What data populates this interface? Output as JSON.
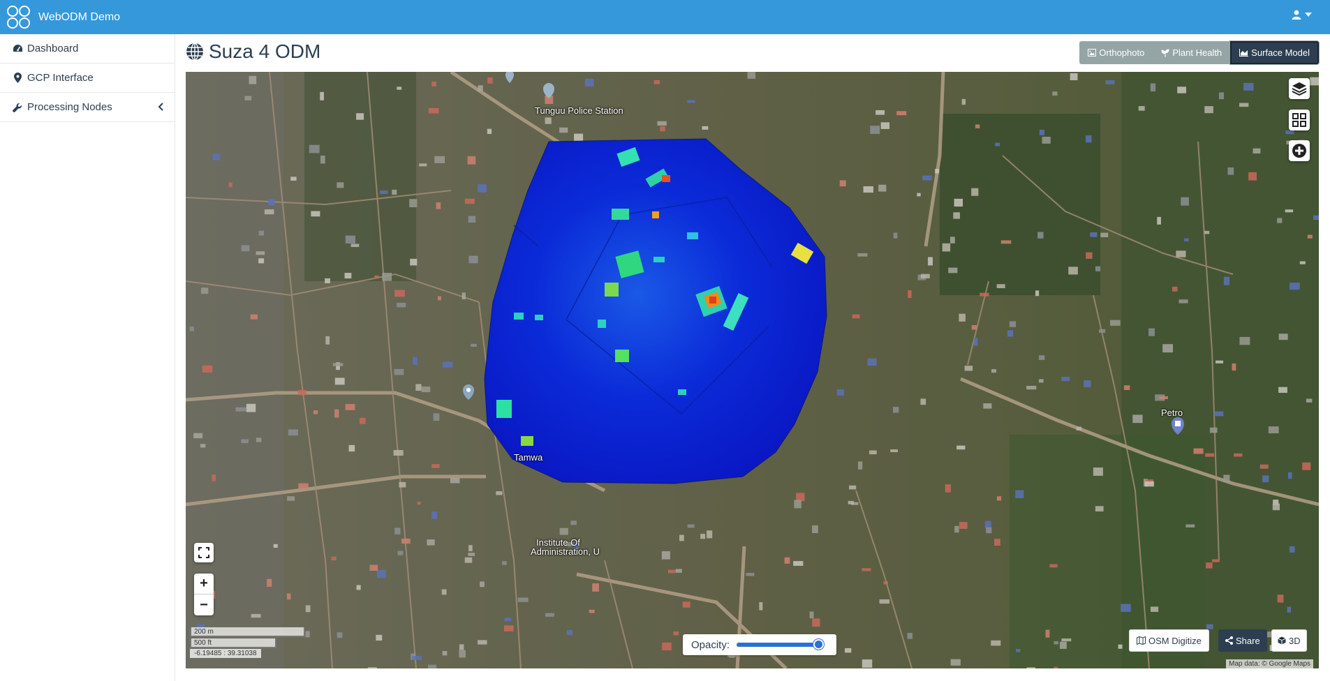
{
  "app": {
    "title": "WebODM Demo"
  },
  "sidebar": {
    "items": [
      {
        "label": "Dashboard",
        "icon": "tachometer-icon"
      },
      {
        "label": "GCP Interface",
        "icon": "map-marker-icon"
      },
      {
        "label": "Processing Nodes",
        "icon": "wrench-icon"
      }
    ]
  },
  "page": {
    "title": "Suza 4 ODM"
  },
  "modes": {
    "orthophoto": "Orthophoto",
    "plant_health": "Plant Health",
    "surface_model": "Surface Model",
    "active": "Surface Model"
  },
  "map": {
    "labels": {
      "police": "Tunguu Police Station",
      "tamwa": "Tamwa",
      "institute_line1": "Institute Of",
      "institute_line2": "Administration, U",
      "petro": "Petro"
    },
    "scale_m": "200 m",
    "scale_ft": "500 ft",
    "coords": "-6.19485 : 39.31038",
    "opacity_label": "Opacity:",
    "opacity_value": 1.0,
    "osm_digitize": "OSM Digitize",
    "share": "Share",
    "three_d": "3D",
    "attribution": "Map data: © Google Maps"
  },
  "colors": {
    "navbar": "#3498db",
    "text": "#2c3e50",
    "button_gray": "#95a5a6",
    "button_dark": "#2c3e50",
    "dsm_low": "#0a1fd6",
    "dsm_high": "#e8401a"
  }
}
